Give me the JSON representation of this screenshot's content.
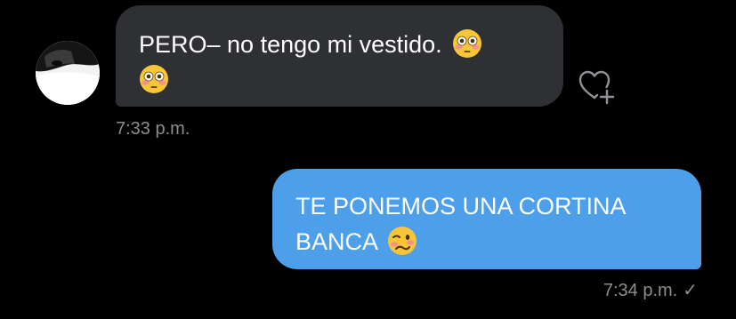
{
  "conversation": {
    "messages": [
      {
        "direction": "incoming",
        "text": "PERO– no tengo mi vestido.",
        "emojis": [
          "flushed-face-emoji",
          "flushed-face-emoji"
        ],
        "timestamp": "7:33 p.m."
      },
      {
        "direction": "outgoing",
        "text_line1": "TE PONEMOS UNA CORTINA",
        "text_line2": "BANCA",
        "emojis": [
          "woozy-face-emoji"
        ],
        "timestamp": "7:34 p.m.",
        "status": "✓"
      }
    ]
  },
  "colors": {
    "background": "#000000",
    "incoming_bubble": "#2e3033",
    "outgoing_bubble": "#4c9fe8",
    "timestamp": "#8a8d91"
  },
  "icons": {
    "like": "heart-plus-icon"
  }
}
